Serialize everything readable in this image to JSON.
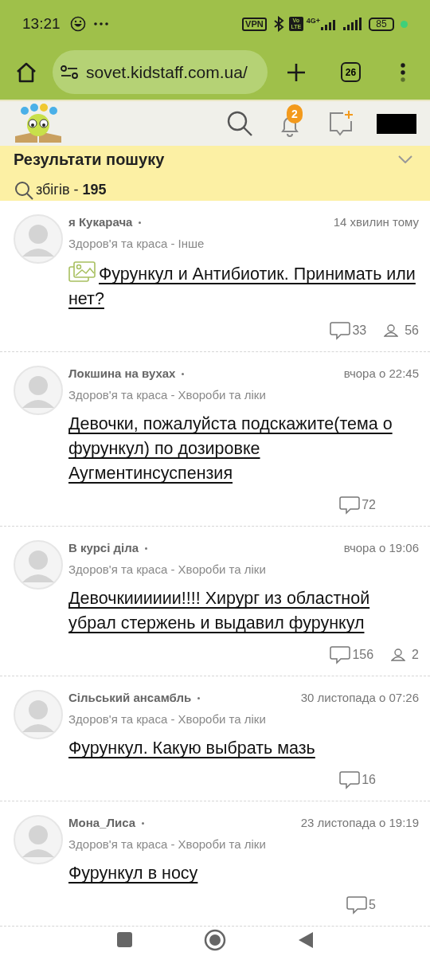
{
  "status_bar": {
    "time": "13:21",
    "vpn": "VPN",
    "volte": "Vo LTE",
    "network": "4G+",
    "battery": "85"
  },
  "browser": {
    "url": "sovet.kidstaff.com.ua/",
    "tab_count": "26"
  },
  "site_header": {
    "notification_count": "2"
  },
  "search_results": {
    "title": "Результати пошуку",
    "matches_label": "збігів - ",
    "matches_count": "195",
    "expanded": false
  },
  "posts": [
    {
      "author": "я Кукарача",
      "time": "14 хвилин тому",
      "category": "Здоров'я та краса - Інше",
      "title": "Фурункул и Антибиотик. Принимать или нет?",
      "has_image": true,
      "comments": "33",
      "participants": "56"
    },
    {
      "author": "Локшина на вухах",
      "time": "вчора о 22:45",
      "category": "Здоров'я та краса - Хвороби та ліки",
      "title": "Девочки, пожалуйста подскажите(тема о фурункул) по дозировке Аугментинсуспензия",
      "has_image": false,
      "comments": "72"
    },
    {
      "author": "В курсі діла",
      "time": "вчора о 19:06",
      "category": "Здоров'я та краса - Хвороби та ліки",
      "title": "Девочкииииии!!!! Хирург из областной убрал стержень и выдавил фурункул",
      "has_image": false,
      "comments": "156",
      "participants": "2"
    },
    {
      "author": "Сільський ансамбль",
      "time": "30 листопада о 07:26",
      "category": "Здоров'я та краса - Хвороби та ліки",
      "title": "Фурункул. Какую выбрать мазь",
      "has_image": false,
      "comments": "16"
    },
    {
      "author": "Мона_Лиса",
      "time": "23 листопада о 19:19",
      "category": "Здоров'я та краса - Хвороби та ліки",
      "title": "Фурункул в носу",
      "has_image": false,
      "comments": "5"
    }
  ]
}
